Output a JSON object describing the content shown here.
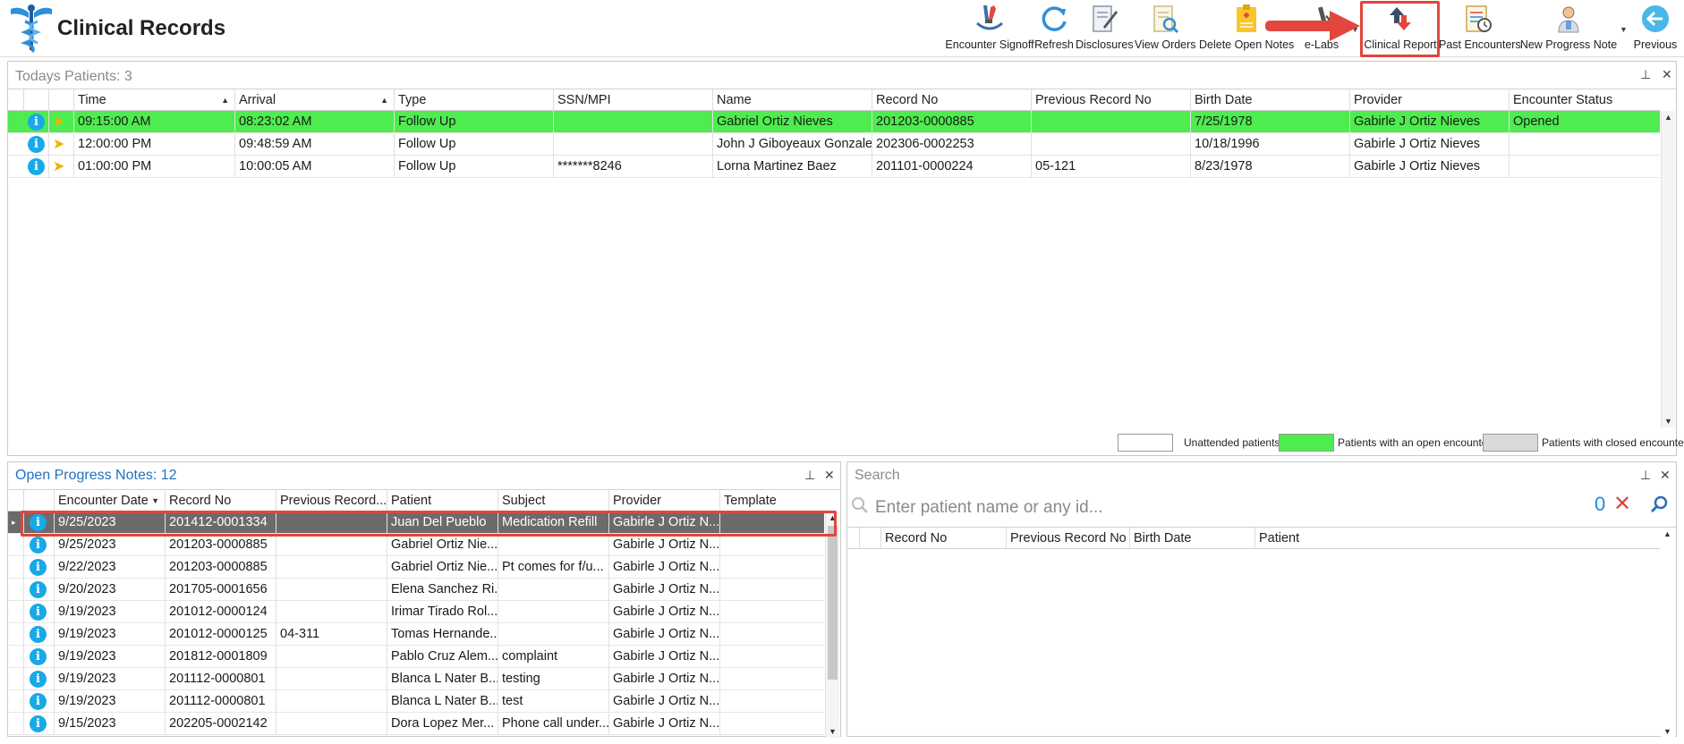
{
  "app": {
    "title": "Clinical Records"
  },
  "toolbar": {
    "encounter_signoff": "Encounter Signoff",
    "refresh": "Refresh",
    "disclosures": "Disclosures",
    "view_orders": "View Orders",
    "delete_open_notes": "Delete Open Notes",
    "e_labs": "e-Labs",
    "clinical_report": "Clinical Report",
    "past_encounters": "Past Encounters",
    "new_progress_note": "New Progress Note",
    "previous": "Previous"
  },
  "todays_patients": {
    "title_label": "Todays Patients:",
    "count": "3",
    "columns": [
      "Time",
      "Arrival",
      "Type",
      "SSN/MPI",
      "Name",
      "Record No",
      "Previous Record No",
      "Birth Date",
      "Provider",
      "Encounter Status"
    ],
    "rows": [
      [
        "09:15:00 AM",
        "08:23:02 AM",
        "Follow Up",
        "",
        "Gabriel Ortiz Nieves",
        "201203-0000885",
        "",
        "7/25/1978",
        "Gabirle J Ortiz Nieves",
        "Opened"
      ],
      [
        "12:00:00 PM",
        "09:48:59 AM",
        "Follow Up",
        "",
        "John J Giboyeaux Gonzalez",
        "202306-0002253",
        "",
        "10/18/1996",
        "Gabirle J Ortiz Nieves",
        ""
      ],
      [
        "01:00:00 PM",
        "10:00:05 AM",
        "Follow Up",
        "*******8246",
        "Lorna Martinez Baez",
        "201101-0000224",
        "05-121",
        "8/23/1978",
        "Gabirle J Ortiz Nieves",
        ""
      ]
    ],
    "legend": {
      "unattended": "Unattended patients",
      "open": "Patients with an open encounter",
      "closed": "Patients with closed encounters"
    }
  },
  "open_notes": {
    "title_label": "Open Progress Notes:",
    "count": "12",
    "columns": [
      "Encounter Date",
      "Record No",
      "Previous Record...",
      "Patient",
      "Subject",
      "Provider",
      "Template"
    ],
    "rows": [
      [
        "9/25/2023",
        "201412-0001334",
        "",
        "Juan Del Pueblo",
        "Medication Refill",
        "Gabirle J Ortiz N...",
        ""
      ],
      [
        "9/25/2023",
        "201203-0000885",
        "",
        "Gabriel Ortiz Nie...",
        "",
        "Gabirle J Ortiz N...",
        ""
      ],
      [
        "9/22/2023",
        "201203-0000885",
        "",
        "Gabriel Ortiz Nie...",
        "Pt comes for f/u...",
        "Gabirle J Ortiz N...",
        ""
      ],
      [
        "9/20/2023",
        "201705-0001656",
        "",
        "Elena Sanchez Ri...",
        "",
        "Gabirle J Ortiz N...",
        ""
      ],
      [
        "9/19/2023",
        "201012-0000124",
        "",
        "Irimar Tirado Rol...",
        "",
        "Gabirle J Ortiz N...",
        ""
      ],
      [
        "9/19/2023",
        "201012-0000125",
        "04-311",
        "Tomas Hernande...",
        "",
        "Gabirle J Ortiz N...",
        ""
      ],
      [
        "9/19/2023",
        "201812-0001809",
        "",
        "Pablo Cruz Alem...",
        "complaint",
        "Gabirle J Ortiz N...",
        ""
      ],
      [
        "9/19/2023",
        "201112-0000801",
        "",
        "Blanca L Nater B...",
        "testing",
        "Gabirle J Ortiz N...",
        ""
      ],
      [
        "9/19/2023",
        "201112-0000801",
        "",
        "Blanca L Nater B...",
        "test",
        "Gabirle J Ortiz N...",
        ""
      ],
      [
        "9/15/2023",
        "202205-0002142",
        "",
        "Dora Lopez Mer...",
        "Phone call under...",
        "Gabirle J Ortiz N...",
        ""
      ]
    ]
  },
  "search": {
    "title": "Search",
    "placeholder": "Enter patient name or any id...",
    "count": "0",
    "columns": [
      "Record No",
      "Previous Record No",
      "Birth Date",
      "Patient"
    ]
  },
  "colors": {
    "open_encounter": "#4eec4e",
    "closed_encounter": "#d9d9d9",
    "info_icon": "#18a9e8",
    "highlight": "#e2463c",
    "accent_blue": "#1e73be"
  }
}
